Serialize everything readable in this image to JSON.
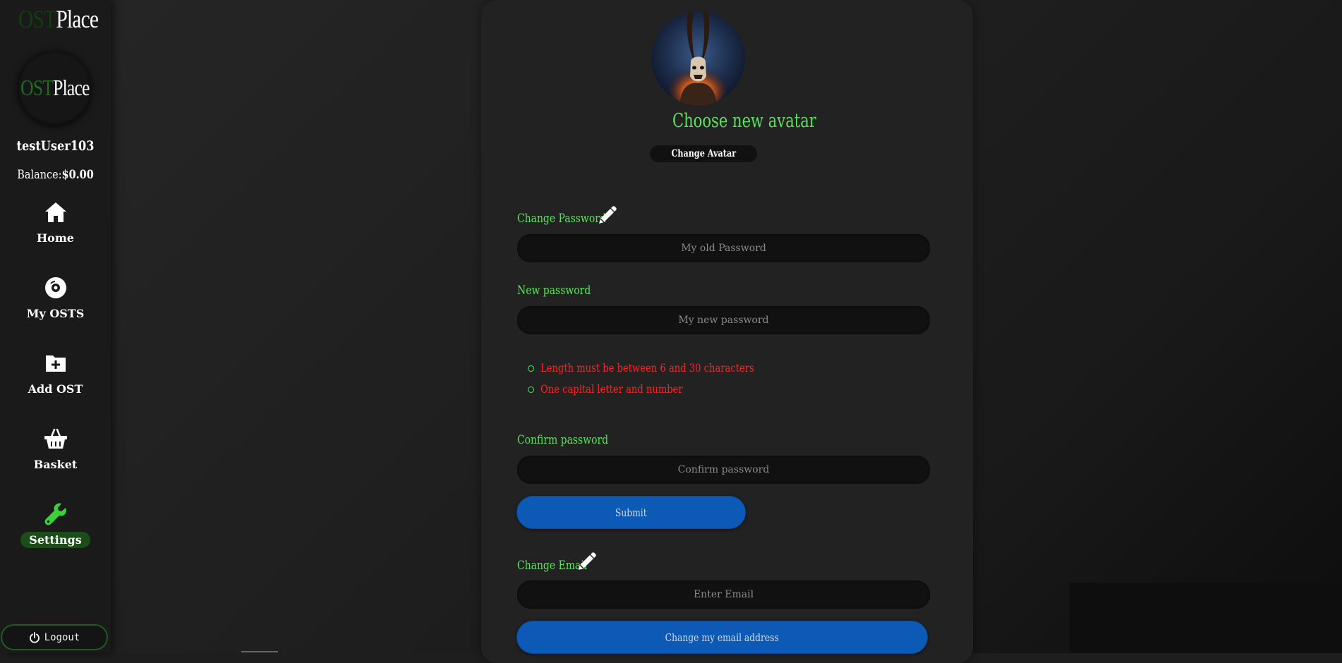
{
  "brand": {
    "ost": "OST",
    "place": "Place"
  },
  "user": {
    "name": "testUser103",
    "balance_label": "Balance:",
    "balance_value": "$0.00"
  },
  "nav": [
    {
      "label": "Home",
      "icon": "home-icon"
    },
    {
      "label": "My OSTS",
      "icon": "disc-icon"
    },
    {
      "label": "Add OST",
      "icon": "folder-plus-icon"
    },
    {
      "label": "Basket",
      "icon": "basket-icon"
    },
    {
      "label": "Settings",
      "icon": "wrench-icon",
      "active": true
    }
  ],
  "logout_label": "Logout",
  "avatar": {
    "title": "Choose new avatar",
    "button": "Change Avatar"
  },
  "password": {
    "change_label": "Change Password",
    "old_placeholder": "My old Password",
    "new_label": "New password",
    "new_placeholder": "My new password",
    "rules": [
      "Length must be between 6 and 30 characters",
      "One capital letter and number"
    ],
    "confirm_label": "Confirm password",
    "confirm_placeholder": "Confirm password",
    "submit": "Submit"
  },
  "email": {
    "change_label": "Change Email",
    "placeholder": "Enter Email",
    "button": "Change my email address"
  },
  "colors": {
    "accent_green": "#5fe05f",
    "error_red": "#ff2222",
    "button_blue": "#0d5ab6",
    "active_nav": "#1b4d17"
  }
}
